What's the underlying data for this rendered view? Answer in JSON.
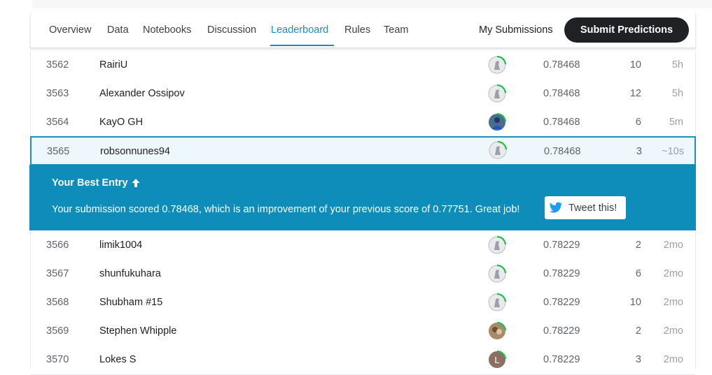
{
  "nav": {
    "tabs": [
      {
        "label": "Overview"
      },
      {
        "label": "Data"
      },
      {
        "label": "Notebooks"
      },
      {
        "label": "Discussion"
      },
      {
        "label": "Leaderboard"
      },
      {
        "label": "Rules"
      },
      {
        "label": "Team"
      }
    ],
    "active_tab": "Leaderboard",
    "my_submissions": "My Submissions",
    "submit_label": "Submit Predictions"
  },
  "rows_before": [
    {
      "rank": "3562",
      "name": "RairiU",
      "avatar": "default-avatar-icon",
      "score": "0.78468",
      "entries": "10",
      "last": "5h"
    },
    {
      "rank": "3563",
      "name": "Alexander Ossipov",
      "avatar": "default-avatar-icon",
      "score": "0.78468",
      "entries": "12",
      "last": "5h"
    },
    {
      "rank": "3564",
      "name": "KayO GH",
      "avatar": "photo-avatar-icon",
      "score": "0.78468",
      "entries": "6",
      "last": "5m"
    },
    {
      "rank": "3565",
      "name": "robsonnunes94",
      "avatar": "default-avatar-icon",
      "score": "0.78468",
      "entries": "3",
      "last": "~10s"
    }
  ],
  "banner": {
    "title": "Your Best Entry",
    "message": "Your submission scored 0.78468, which is an improvement of your previous score of 0.77751. Great job!",
    "tweet_label": "Tweet this!"
  },
  "rows_after": [
    {
      "rank": "3566",
      "name": "limik1004",
      "avatar": "default-avatar-icon",
      "score": "0.78229",
      "entries": "2",
      "last": "2mo"
    },
    {
      "rank": "3567",
      "name": "shunfukuhara",
      "avatar": "default-avatar-icon",
      "score": "0.78229",
      "entries": "6",
      "last": "2mo"
    },
    {
      "rank": "3568",
      "name": "Shubham #15",
      "avatar": "default-avatar-icon",
      "score": "0.78229",
      "entries": "10",
      "last": "2mo"
    },
    {
      "rank": "3569",
      "name": "Stephen Whipple",
      "avatar": "photo-avatar-icon",
      "score": "0.78229",
      "entries": "2",
      "last": "2mo"
    },
    {
      "rank": "3570",
      "name": "Lokes S",
      "avatar": "letter-avatar-icon",
      "avatar_letter": "L",
      "score": "0.78229",
      "entries": "3",
      "last": "2mo"
    }
  ],
  "colors": {
    "accent": "#1e88c8",
    "banner": "#0e8dba",
    "highlight_row": "#eef8fc",
    "progress_ring": "#20be4c",
    "submit_button": "#202124"
  }
}
